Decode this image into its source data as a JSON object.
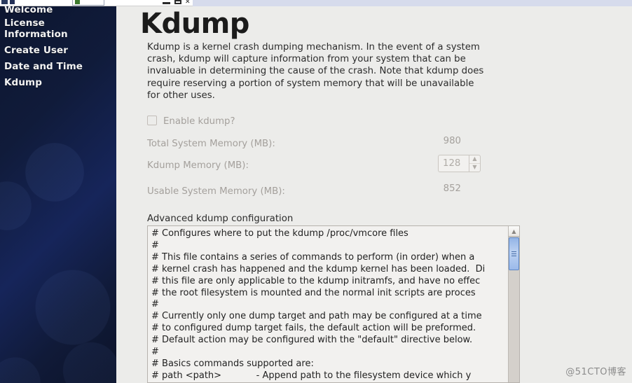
{
  "window_chrome": {
    "minimize_icon": "minimize-icon",
    "restore_icon": "restore-icon",
    "close_icon": "close-icon",
    "close_glyph": "✕"
  },
  "sidebar": {
    "items": [
      {
        "label": "Welcome",
        "name": "sidebar-item-welcome"
      },
      {
        "label": "License\nInformation",
        "name": "sidebar-item-license-information"
      },
      {
        "label": "Create User",
        "name": "sidebar-item-create-user"
      },
      {
        "label": "Date and Time",
        "name": "sidebar-item-date-and-time"
      },
      {
        "label": "Kdump",
        "name": "sidebar-item-kdump"
      }
    ]
  },
  "main": {
    "title": "Kdump",
    "intro": "Kdump is a kernel crash dumping mechanism. In the event of a system crash, kdump will capture information from your system that can be invaluable in determining the cause of the crash. Note that kdump does require reserving a portion of system memory that will be unavailable for other uses.",
    "enable_checkbox_label": "Enable kdump?",
    "enable_checkbox_checked": false,
    "fields": [
      {
        "label": "Total System Memory (MB):",
        "value": "980"
      },
      {
        "label": "Kdump Memory (MB):",
        "value": "128"
      },
      {
        "label": "Usable System Memory (MB):",
        "value": "852"
      }
    ],
    "spinner": {
      "value": "128",
      "up_glyph": "▲",
      "down_glyph": "▼"
    },
    "advanced_label": "Advanced kdump configuration",
    "advanced_config_text": "# Configures where to put the kdump /proc/vmcore files\n#\n# This file contains a series of commands to perform (in order) when a\n# kernel crash has happened and the kdump kernel has been loaded.  Di\n# this file are only applicable to the kdump initramfs, and have no effec\n# the root filesystem is mounted and the normal init scripts are proces\n#\n# Currently only one dump target and path may be configured at a time\n# to configured dump target fails, the default action will be preformed.\n# Default action may be configured with the \"default\" directive below.\n#\n# Basics commands supported are:\n# path <path>            - Append path to the filesystem device which y",
    "scrollbar": {
      "up_glyph": "▲"
    }
  },
  "watermark": "@51CTO博客",
  "colors": {
    "sidebar_dark": "#101b3a",
    "sidebar_accent": "#16255a",
    "content_bg": "#ececea",
    "disabled_text": "#a4a09c",
    "scrollbar_thumb": "#9bbaea",
    "chrome_bar": "#d6dbec"
  }
}
